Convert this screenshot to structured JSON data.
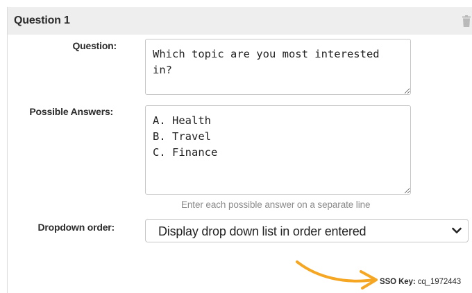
{
  "panel": {
    "title": "Question 1",
    "delete_icon": "trash-icon"
  },
  "form": {
    "question_label": "Question:",
    "question_value": "Which topic are you most interested in?",
    "answers_label": "Possible Answers:",
    "answers_value": "A. Health\nB. Travel\nC. Finance",
    "answers_hint": "Enter each possible answer on a separate line",
    "order_label": "Dropdown order:",
    "order_value": "Display drop down list in order entered",
    "order_icon": "chevron-down-icon"
  },
  "sso": {
    "label": "SSO Key:",
    "value": "cq_1972443"
  },
  "colors": {
    "header_bg": "#eeeeee",
    "arrow": "#f5a623",
    "hint_text": "#8a8a8a"
  }
}
